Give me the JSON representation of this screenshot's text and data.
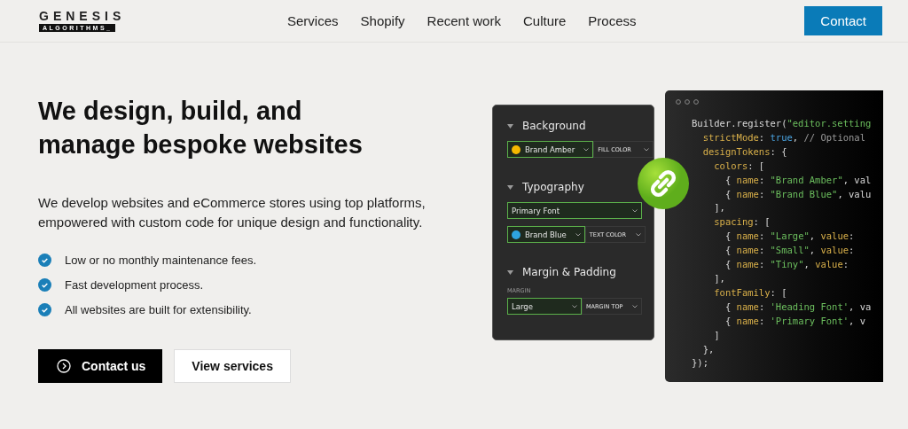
{
  "header": {
    "logo": {
      "top": "GENESIS",
      "bottom": "ALGORITHMS_"
    },
    "nav": [
      {
        "label": "Services"
      },
      {
        "label": "Shopify"
      },
      {
        "label": "Recent work"
      },
      {
        "label": "Culture"
      },
      {
        "label": "Process"
      }
    ],
    "cta": "Contact"
  },
  "hero": {
    "title": "We design, build, and manage bespoke websites",
    "text": "We develop websites and eCommerce stores using top platforms, empowered with custom code for unique design and functionality.",
    "features": [
      "Low or no monthly maintenance fees.",
      "Fast development process.",
      "All websites are built for extensibility."
    ],
    "buttons": [
      {
        "kind": "primary",
        "label": "Contact us"
      },
      {
        "kind": "secondary",
        "label": "View services"
      }
    ]
  },
  "editor": {
    "sections": [
      {
        "title": "Background",
        "rows": [
          {
            "controls": [
              {
                "kind": "value",
                "text": "Brand Amber",
                "color": "#f5b800",
                "highlighted": true
              },
              {
                "kind": "property",
                "text": "FILL COLOR",
                "highlighted": false
              }
            ]
          }
        ]
      },
      {
        "title": "Typography",
        "rows": [
          {
            "controls": [
              {
                "kind": "value",
                "text": "Primary Font",
                "highlighted": true
              }
            ]
          },
          {
            "controls": [
              {
                "kind": "value",
                "text": "Brand Blue",
                "color": "#2ea3e0",
                "highlighted": true
              },
              {
                "kind": "property",
                "text": "TEXT COLOR",
                "highlighted": false
              }
            ]
          }
        ]
      },
      {
        "title": "Margin & Padding",
        "rows": [
          {
            "caption": "MARGIN",
            "controls": [
              {
                "kind": "value",
                "text": "Large",
                "highlighted": true
              },
              {
                "kind": "property",
                "text": "MARGIN TOP",
                "highlighted": false
              }
            ]
          }
        ]
      }
    ]
  },
  "code": [
    [
      {
        "kind": "plain",
        "text": "Builder.register("
      },
      {
        "kind": "string",
        "text": "\"editor.setting"
      }
    ],
    [
      {
        "kind": "key",
        "text": "  strictMode"
      },
      {
        "kind": "plain",
        "text": ": "
      },
      {
        "kind": "keyword",
        "text": "true"
      },
      {
        "kind": "plain",
        "text": ", "
      },
      {
        "kind": "comment",
        "text": "// Optional"
      }
    ],
    [
      {
        "kind": "key",
        "text": "  designTokens"
      },
      {
        "kind": "plain",
        "text": ": {"
      }
    ],
    [
      {
        "kind": "key",
        "text": "    colors"
      },
      {
        "kind": "plain",
        "text": ": ["
      }
    ],
    [
      {
        "kind": "plain",
        "text": "      { "
      },
      {
        "kind": "key",
        "text": "name"
      },
      {
        "kind": "plain",
        "text": ": "
      },
      {
        "kind": "string",
        "text": "\"Brand Amber\""
      },
      {
        "kind": "plain",
        "text": ", val"
      }
    ],
    [
      {
        "kind": "plain",
        "text": "      { "
      },
      {
        "kind": "key",
        "text": "name"
      },
      {
        "kind": "plain",
        "text": ": "
      },
      {
        "kind": "string",
        "text": "\"Brand Blue\""
      },
      {
        "kind": "plain",
        "text": ", valu"
      }
    ],
    [
      {
        "kind": "plain",
        "text": "    ],"
      }
    ],
    [
      {
        "kind": "key",
        "text": "    spacing"
      },
      {
        "kind": "plain",
        "text": ": ["
      }
    ],
    [
      {
        "kind": "plain",
        "text": "      { "
      },
      {
        "kind": "key",
        "text": "name"
      },
      {
        "kind": "plain",
        "text": ": "
      },
      {
        "kind": "string",
        "text": "\"Large\""
      },
      {
        "kind": "plain",
        "text": ", "
      },
      {
        "kind": "key",
        "text": "value"
      },
      {
        "kind": "plain",
        "text": ": "
      }
    ],
    [
      {
        "kind": "plain",
        "text": "      { "
      },
      {
        "kind": "key",
        "text": "name"
      },
      {
        "kind": "plain",
        "text": ": "
      },
      {
        "kind": "string",
        "text": "\"Small\""
      },
      {
        "kind": "plain",
        "text": ", "
      },
      {
        "kind": "key",
        "text": "value"
      },
      {
        "kind": "plain",
        "text": ": "
      }
    ],
    [
      {
        "kind": "plain",
        "text": "      { "
      },
      {
        "kind": "key",
        "text": "name"
      },
      {
        "kind": "plain",
        "text": ": "
      },
      {
        "kind": "string",
        "text": "\"Tiny\""
      },
      {
        "kind": "plain",
        "text": ", "
      },
      {
        "kind": "key",
        "text": "value"
      },
      {
        "kind": "plain",
        "text": ": "
      }
    ],
    [
      {
        "kind": "plain",
        "text": "    ],"
      }
    ],
    [
      {
        "kind": "key",
        "text": "    fontFamily"
      },
      {
        "kind": "plain",
        "text": ": ["
      }
    ],
    [
      {
        "kind": "plain",
        "text": "      { "
      },
      {
        "kind": "key",
        "text": "name"
      },
      {
        "kind": "plain",
        "text": ": "
      },
      {
        "kind": "string",
        "text": "'Heading Font'"
      },
      {
        "kind": "plain",
        "text": ", va"
      }
    ],
    [
      {
        "kind": "plain",
        "text": "      { "
      },
      {
        "kind": "key",
        "text": "name"
      },
      {
        "kind": "plain",
        "text": ": "
      },
      {
        "kind": "string",
        "text": "'Primary Font'"
      },
      {
        "kind": "plain",
        "text": ", v"
      }
    ],
    [
      {
        "kind": "plain",
        "text": "    ]"
      }
    ],
    [
      {
        "kind": "plain",
        "text": "  },"
      }
    ],
    [
      {
        "kind": "plain",
        "text": "});"
      }
    ]
  ]
}
